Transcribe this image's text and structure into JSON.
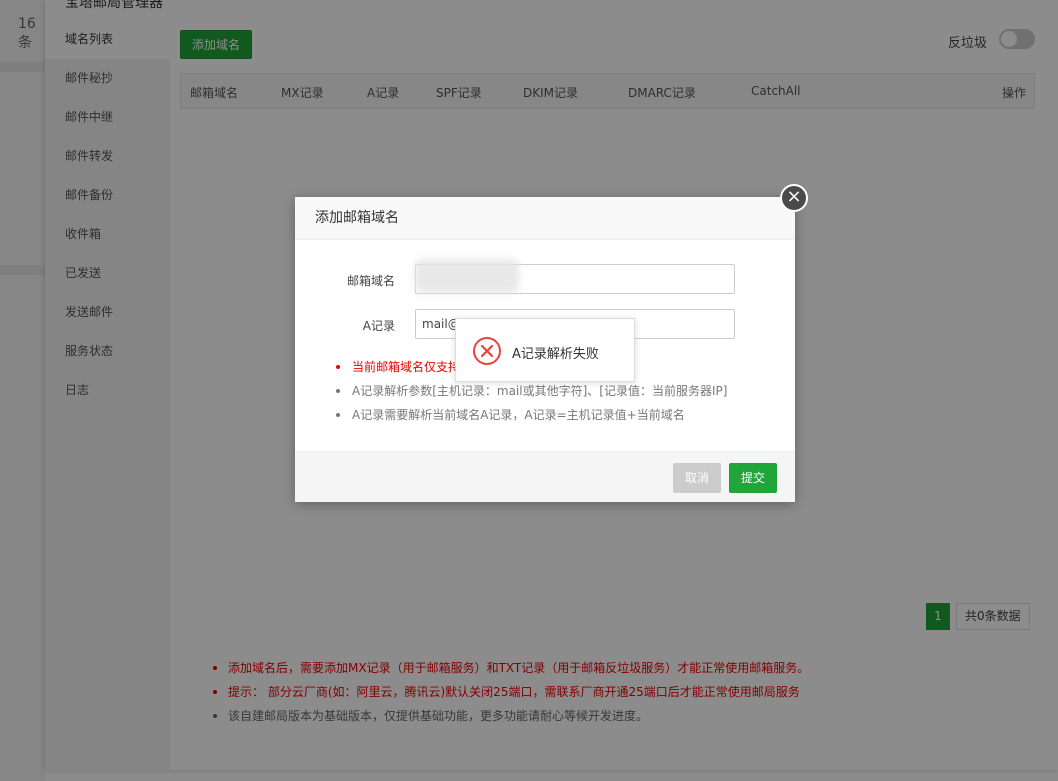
{
  "background": {
    "left_text": "16 条",
    "panel_title": "宝塔邮局管理器"
  },
  "sidebar": {
    "items": [
      {
        "label": "域名列表",
        "active": true
      },
      {
        "label": "邮件秘抄"
      },
      {
        "label": "邮件中继"
      },
      {
        "label": "邮件转发"
      },
      {
        "label": "邮件备份"
      },
      {
        "label": "收件箱"
      },
      {
        "label": "已发送"
      },
      {
        "label": "发送邮件"
      },
      {
        "label": "服务状态"
      },
      {
        "label": "日志"
      }
    ]
  },
  "toolbar": {
    "add_domain_label": "添加域名",
    "spam_label": "反垃圾",
    "spam_enabled": false
  },
  "table": {
    "columns": [
      "邮箱域名",
      "MX记录",
      "A记录",
      "SPF记录",
      "DKIM记录",
      "DMARC记录",
      "CatchAll",
      "操作"
    ],
    "rows": []
  },
  "pagination": {
    "current_page": "1",
    "total_text": "共0条数据"
  },
  "notes": [
    {
      "text": "添加域名后，需要添加MX记录（用于邮箱服务）和TXT记录（用于邮箱反垃圾服务）才能正常使用邮箱服务。",
      "color": "red"
    },
    {
      "text": "提示： 部分云厂商(如：阿里云，腾讯云)默认关闭25端口，需联系厂商开通25端口后才能正常使用邮局服务",
      "color": "red"
    },
    {
      "text": "该自建邮局版本为基础版本，仅提供基础功能，更多功能请耐心等候开发进度。",
      "color": "gray"
    }
  ],
  "modal": {
    "title": "添加邮箱域名",
    "close_icon": "close-icon",
    "domain_label": "邮箱域名",
    "domain_value": "",
    "a_record_label": "A记录",
    "a_record_value": "mail@",
    "notes": [
      {
        "text": "当前邮箱域名仅支持",
        "color": "red"
      },
      {
        "text": "A记录解析参数[主机记录：mail或其他字符]、[记录值：当前服务器IP]",
        "color": "gray"
      },
      {
        "text": "A记录需要解析当前域名A记录，A记录=主机记录值+当前域名",
        "color": "gray"
      }
    ],
    "cancel_label": "取消",
    "submit_label": "提交"
  },
  "toast": {
    "message": "A记录解析失败",
    "icon": "error-icon",
    "color": "#e8443a"
  },
  "colors": {
    "accent": "#20a53a",
    "error": "#e00000"
  }
}
